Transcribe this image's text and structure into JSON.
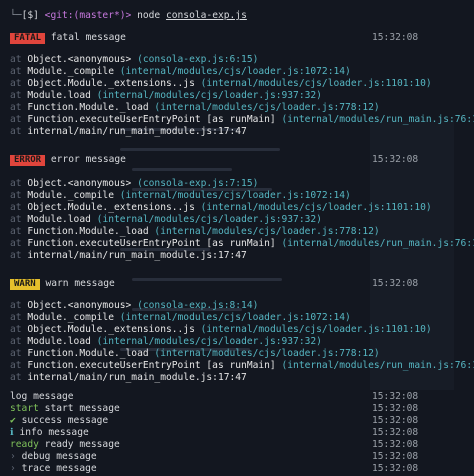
{
  "prompt": {
    "dir": "[$]",
    "git_label": "<git:(master*)>",
    "command": "node",
    "file": "consola-exp.js"
  },
  "colors": {
    "fatal": "#e0453c",
    "error": "#e0453c",
    "warn": "#e5c02c",
    "path": "#56b6c2",
    "success": "#7fc15a"
  },
  "blocks": [
    {
      "badge": "FATAL",
      "message": "fatal message",
      "time": "15:32:08",
      "stack": [
        {
          "at": "at",
          "fn": "Object.<anonymous>",
          "loc": "(consola-exp.js:6:15)"
        },
        {
          "at": "at",
          "fn": "Module._compile",
          "loc": "(internal/modules/cjs/loader.js:1072:14)"
        },
        {
          "at": "at",
          "fn": "Object.Module._extensions..js",
          "loc": "(internal/modules/cjs/loader.js:1101:10)"
        },
        {
          "at": "at",
          "fn": "Module.load",
          "loc": "(internal/modules/cjs/loader.js:937:32)"
        },
        {
          "at": "at",
          "fn": "Function.Module._load",
          "loc": "(internal/modules/cjs/loader.js:778:12)"
        },
        {
          "at": "at",
          "fn": "Function.executeUserEntryPoint [as runMain]",
          "loc": "(internal/modules/run_main.js:76:12)"
        },
        {
          "at": "at",
          "fn": "internal/main/run_main_module.js:17:47",
          "loc": ""
        }
      ]
    },
    {
      "badge": "ERROR",
      "message": "error message",
      "time": "15:32:08",
      "stack": [
        {
          "at": "at",
          "fn": "Object.<anonymous>",
          "loc": "(consola-exp.js:7:15)"
        },
        {
          "at": "at",
          "fn": "Module._compile",
          "loc": "(internal/modules/cjs/loader.js:1072:14)"
        },
        {
          "at": "at",
          "fn": "Object.Module._extensions..js",
          "loc": "(internal/modules/cjs/loader.js:1101:10)"
        },
        {
          "at": "at",
          "fn": "Module.load",
          "loc": "(internal/modules/cjs/loader.js:937:32)"
        },
        {
          "at": "at",
          "fn": "Function.Module._load",
          "loc": "(internal/modules/cjs/loader.js:778:12)"
        },
        {
          "at": "at",
          "fn": "Function.executeUserEntryPoint [as runMain]",
          "loc": "(internal/modules/run_main.js:76:12)"
        },
        {
          "at": "at",
          "fn": "internal/main/run_main_module.js:17:47",
          "loc": ""
        }
      ]
    },
    {
      "badge": "WARN",
      "message": "warn message",
      "time": "15:32:08",
      "stack": [
        {
          "at": "at",
          "fn": "Object.<anonymous>",
          "loc": "(consola-exp.js:8:14)"
        },
        {
          "at": "at",
          "fn": "Module._compile",
          "loc": "(internal/modules/cjs/loader.js:1072:14)"
        },
        {
          "at": "at",
          "fn": "Object.Module._extensions..js",
          "loc": "(internal/modules/cjs/loader.js:1101:10)"
        },
        {
          "at": "at",
          "fn": "Module.load",
          "loc": "(internal/modules/cjs/loader.js:937:32)"
        },
        {
          "at": "at",
          "fn": "Function.Module._load",
          "loc": "(internal/modules/cjs/loader.js:778:12)"
        },
        {
          "at": "at",
          "fn": "Function.executeUserEntryPoint [as runMain]",
          "loc": "(internal/modules/run_main.js:76:12)"
        },
        {
          "at": "at",
          "fn": "internal/main/run_main_module.js:17:47",
          "loc": ""
        }
      ]
    }
  ],
  "simple": [
    {
      "prefix": "",
      "text": "log message",
      "time": "15:32:08"
    },
    {
      "prefix": "start",
      "text": "start message",
      "time": "15:32:08"
    },
    {
      "prefix": "✔",
      "text": "success message",
      "time": "15:32:08"
    },
    {
      "prefix": "ℹ",
      "text": "info message",
      "time": "15:32:08"
    },
    {
      "prefix": "ready",
      "text": "ready message",
      "time": "15:32:08"
    },
    {
      "prefix": "›",
      "text": "debug message",
      "time": "15:32:08"
    },
    {
      "prefix": "›",
      "text": "trace message",
      "time": "15:32:08"
    }
  ]
}
